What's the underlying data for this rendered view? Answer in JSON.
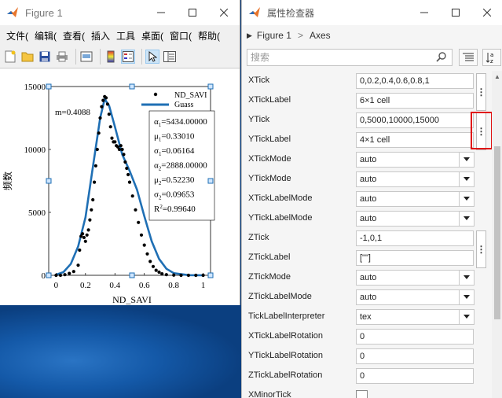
{
  "figure": {
    "title": "Figure 1",
    "menus": [
      "文件(",
      "编辑(",
      "查看(",
      "插入",
      "工具",
      "桌面(",
      "窗口(",
      "帮助("
    ],
    "toolbar_icons": [
      "new-file-icon",
      "open-folder-icon",
      "save-icon",
      "print-icon",
      "print-preview-icon",
      "colorbar-icon",
      "legend-icon",
      "pointer-icon",
      "property-editor-icon"
    ],
    "chart": {
      "ylabel": "频数",
      "xlabel": "ND_SAVI",
      "annotation": "m=0.4088",
      "legend": {
        "scatter": "ND_SAVI",
        "line": "Guass"
      },
      "params": [
        {
          "sym": "α",
          "sub": "1",
          "val": "=5434.00000"
        },
        {
          "sym": "μ",
          "sub": "1",
          "val": "=0.33010"
        },
        {
          "sym": "σ",
          "sub": "1",
          "val": "=0.06164"
        },
        {
          "sym": "α",
          "sub": "2",
          "val": "=2888.00000"
        },
        {
          "sym": "μ",
          "sub": "2",
          "val": "=0.52230"
        },
        {
          "sym": "σ",
          "sub": "2",
          "val": "=0.09653"
        },
        {
          "sym": "R",
          "sup": "2",
          "val": "=0.99640"
        }
      ]
    }
  },
  "chart_data": {
    "type": "scatter",
    "xlabel": "ND_SAVI",
    "ylabel": "频数",
    "xlim": [
      -0.05,
      1.05
    ],
    "ylim": [
      0,
      15000
    ],
    "xticks": [
      "0",
      "0.2",
      "0.4",
      "0.6",
      "0.8",
      "1"
    ],
    "xtick_values": [
      0,
      0.2,
      0.4,
      0.6,
      0.8,
      1
    ],
    "yticks": [
      "0",
      "5000",
      "10000",
      "15000"
    ],
    "ytick_values": [
      0,
      5000,
      10000,
      15000
    ],
    "series": [
      {
        "name": "ND_SAVI",
        "kind": "scatter",
        "x": [
          0.0,
          0.03,
          0.06,
          0.09,
          0.12,
          0.15,
          0.16,
          0.17,
          0.18,
          0.19,
          0.2,
          0.21,
          0.22,
          0.23,
          0.24,
          0.25,
          0.26,
          0.27,
          0.28,
          0.29,
          0.3,
          0.31,
          0.32,
          0.33,
          0.34,
          0.35,
          0.36,
          0.37,
          0.38,
          0.39,
          0.4,
          0.41,
          0.42,
          0.43,
          0.44,
          0.45,
          0.46,
          0.47,
          0.48,
          0.49,
          0.5,
          0.52,
          0.54,
          0.56,
          0.58,
          0.6,
          0.62,
          0.64,
          0.66,
          0.68,
          0.7,
          0.72,
          0.75,
          0.8,
          0.85,
          0.9,
          0.95,
          1.0
        ],
        "y": [
          0,
          0,
          50,
          150,
          300,
          800,
          2000,
          3100,
          3300,
          3000,
          2700,
          3200,
          3600,
          4400,
          5200,
          6000,
          7400,
          8700,
          10000,
          11300,
          12500,
          13400,
          13900,
          14200,
          14100,
          13600,
          12800,
          11800,
          10900,
          10600,
          10600,
          10300,
          10200,
          10000,
          10300,
          10000,
          9600,
          9000,
          8500,
          8000,
          7400,
          6300,
          5200,
          4200,
          3200,
          2400,
          1700,
          1100,
          700,
          400,
          250,
          120,
          50,
          10,
          0,
          0,
          0,
          0
        ]
      },
      {
        "name": "Guass",
        "kind": "line",
        "x": [
          0.0,
          0.05,
          0.1,
          0.15,
          0.2,
          0.25,
          0.3,
          0.33,
          0.36,
          0.4,
          0.45,
          0.5,
          0.55,
          0.6,
          0.65,
          0.7,
          0.75,
          0.8,
          0.9,
          1.0
        ],
        "y": [
          50,
          250,
          900,
          2300,
          4600,
          8600,
          12500,
          14000,
          13500,
          11800,
          9600,
          8300,
          6800,
          4700,
          2700,
          1300,
          520,
          170,
          10,
          0
        ]
      }
    ],
    "grid": false,
    "legend_position": "top-right"
  },
  "inspector": {
    "title": "属性检查器",
    "breadcrumb": [
      "Figure 1",
      "Axes"
    ],
    "search_placeholder": "搜索",
    "properties": [
      {
        "label": "XTick",
        "type": "text",
        "value": "0,0.2,0.4,0.6,0.8,1"
      },
      {
        "label": "XTickLabel",
        "type": "text",
        "value": "6×1 cell"
      },
      {
        "label": "YTick",
        "type": "text",
        "value": "0,5000,10000,15000"
      },
      {
        "label": "YTickLabel",
        "type": "text",
        "value": "4×1 cell"
      },
      {
        "label": "XTickMode",
        "type": "dropdown",
        "value": "auto"
      },
      {
        "label": "YTickMode",
        "type": "dropdown",
        "value": "auto"
      },
      {
        "label": "XTickLabelMode",
        "type": "dropdown",
        "value": "auto"
      },
      {
        "label": "YTickLabelMode",
        "type": "dropdown",
        "value": "auto"
      },
      {
        "label": "ZTick",
        "type": "text",
        "value": "-1,0,1"
      },
      {
        "label": "ZTickLabel",
        "type": "text",
        "value": "[\"\"]"
      },
      {
        "label": "ZTickMode",
        "type": "dropdown",
        "value": "auto"
      },
      {
        "label": "ZTickLabelMode",
        "type": "dropdown",
        "value": "auto"
      },
      {
        "label": "TickLabelInterpreter",
        "type": "dropdown",
        "value": "tex"
      },
      {
        "label": "XTickLabelRotation",
        "type": "text",
        "value": "0"
      },
      {
        "label": "YTickLabelRotation",
        "type": "text",
        "value": "0"
      },
      {
        "label": "ZTickLabelRotation",
        "type": "text",
        "value": "0"
      },
      {
        "label": "XMinorTick",
        "type": "checkbox",
        "value": ""
      }
    ]
  },
  "colors": {
    "highlight": "#e01010",
    "gauss_line": "#1f6fb4",
    "scatter": "#000000"
  }
}
